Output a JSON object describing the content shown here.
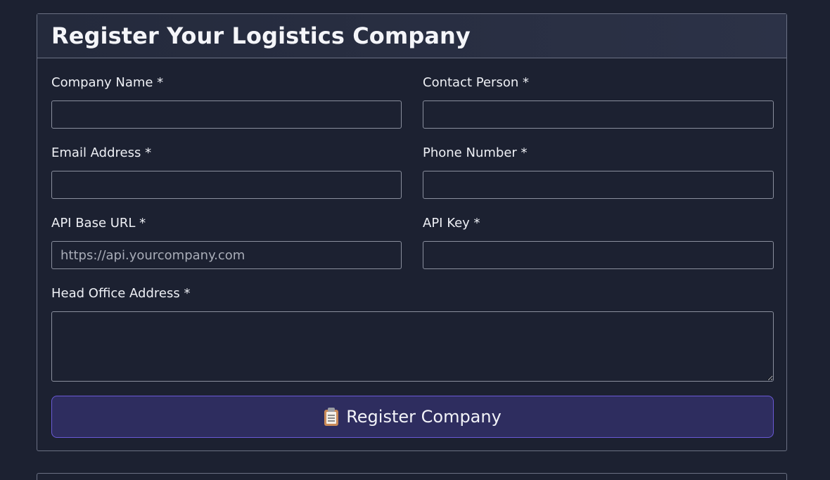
{
  "form": {
    "title": "Register Your Logistics Company",
    "fields": {
      "company_name": {
        "label": "Company Name *",
        "value": "",
        "placeholder": ""
      },
      "contact_person": {
        "label": "Contact Person *",
        "value": "",
        "placeholder": ""
      },
      "email": {
        "label": "Email Address *",
        "value": "",
        "placeholder": ""
      },
      "phone": {
        "label": "Phone Number *",
        "value": "",
        "placeholder": ""
      },
      "api_base_url": {
        "label": "API Base URL *",
        "value": "",
        "placeholder": "https://api.yourcompany.com"
      },
      "api_key": {
        "label": "API Key *",
        "value": "",
        "placeholder": ""
      },
      "head_office_address": {
        "label": "Head Office Address *",
        "value": "",
        "placeholder": ""
      }
    },
    "submit_label": "Register Company",
    "submit_icon": "clipboard-icon"
  },
  "colors": {
    "background": "#1c2131",
    "header_bg": "#2c3247",
    "border": "#6b7184",
    "button_bg": "#2e2d5f",
    "button_border": "#6a5ad6",
    "text": "#eef0f5"
  }
}
